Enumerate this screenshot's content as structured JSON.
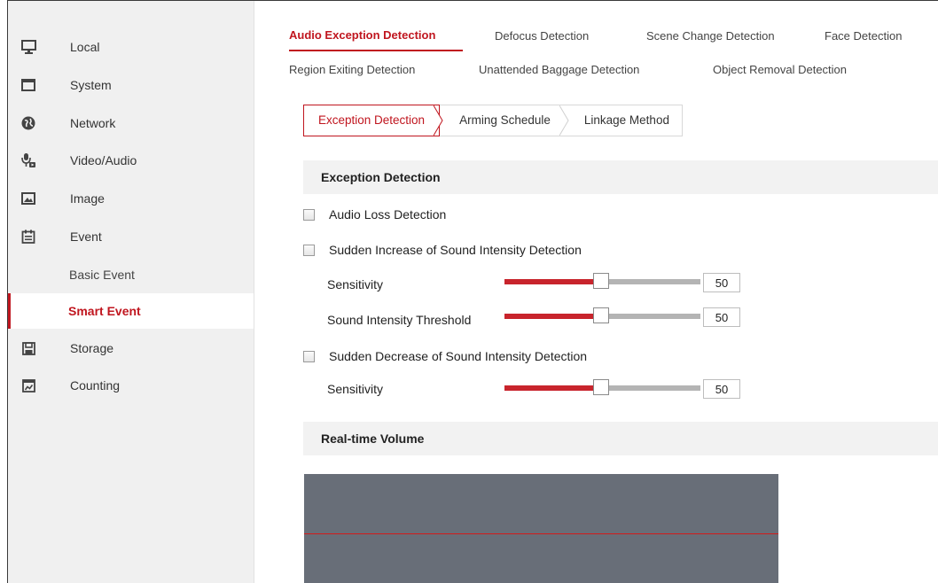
{
  "sidebar": {
    "items": [
      {
        "label": "Local",
        "icon": "monitor-icon"
      },
      {
        "label": "System",
        "icon": "window-icon"
      },
      {
        "label": "Network",
        "icon": "globe-icon"
      },
      {
        "label": "Video/Audio",
        "icon": "camera-mic-icon"
      },
      {
        "label": "Image",
        "icon": "image-icon"
      },
      {
        "label": "Event",
        "icon": "calendar-icon"
      },
      {
        "label": "Basic Event"
      },
      {
        "label": "Smart Event",
        "active": true
      },
      {
        "label": "Storage",
        "icon": "storage-icon"
      },
      {
        "label": "Counting",
        "icon": "chart-icon"
      }
    ]
  },
  "tabs": {
    "row1": [
      "Audio Exception Detection",
      "Defocus Detection",
      "Scene Change Detection",
      "Face Detection"
    ],
    "row2": [
      "Region Exiting Detection",
      "Unattended Baggage Detection",
      "Object Removal Detection"
    ],
    "active": "Audio Exception Detection"
  },
  "subtabs": [
    "Exception Detection",
    "Arming Schedule",
    "Linkage Method"
  ],
  "exception": {
    "header": "Exception Detection",
    "audio_loss": "Audio Loss Detection",
    "sudden_increase": "Sudden Increase of Sound Intensity Detection",
    "sensitivity_label": "Sensitivity",
    "threshold_label": "Sound Intensity Threshold",
    "sudden_decrease": "Sudden Decrease of Sound Intensity Detection",
    "increase_sensitivity": "50",
    "increase_threshold": "50",
    "decrease_sensitivity": "50"
  },
  "volume": {
    "header": "Real-time Volume"
  },
  "colors": {
    "accent": "#c0161f",
    "slider_fill": "#c8242c",
    "volume_bg": "#686e78"
  }
}
